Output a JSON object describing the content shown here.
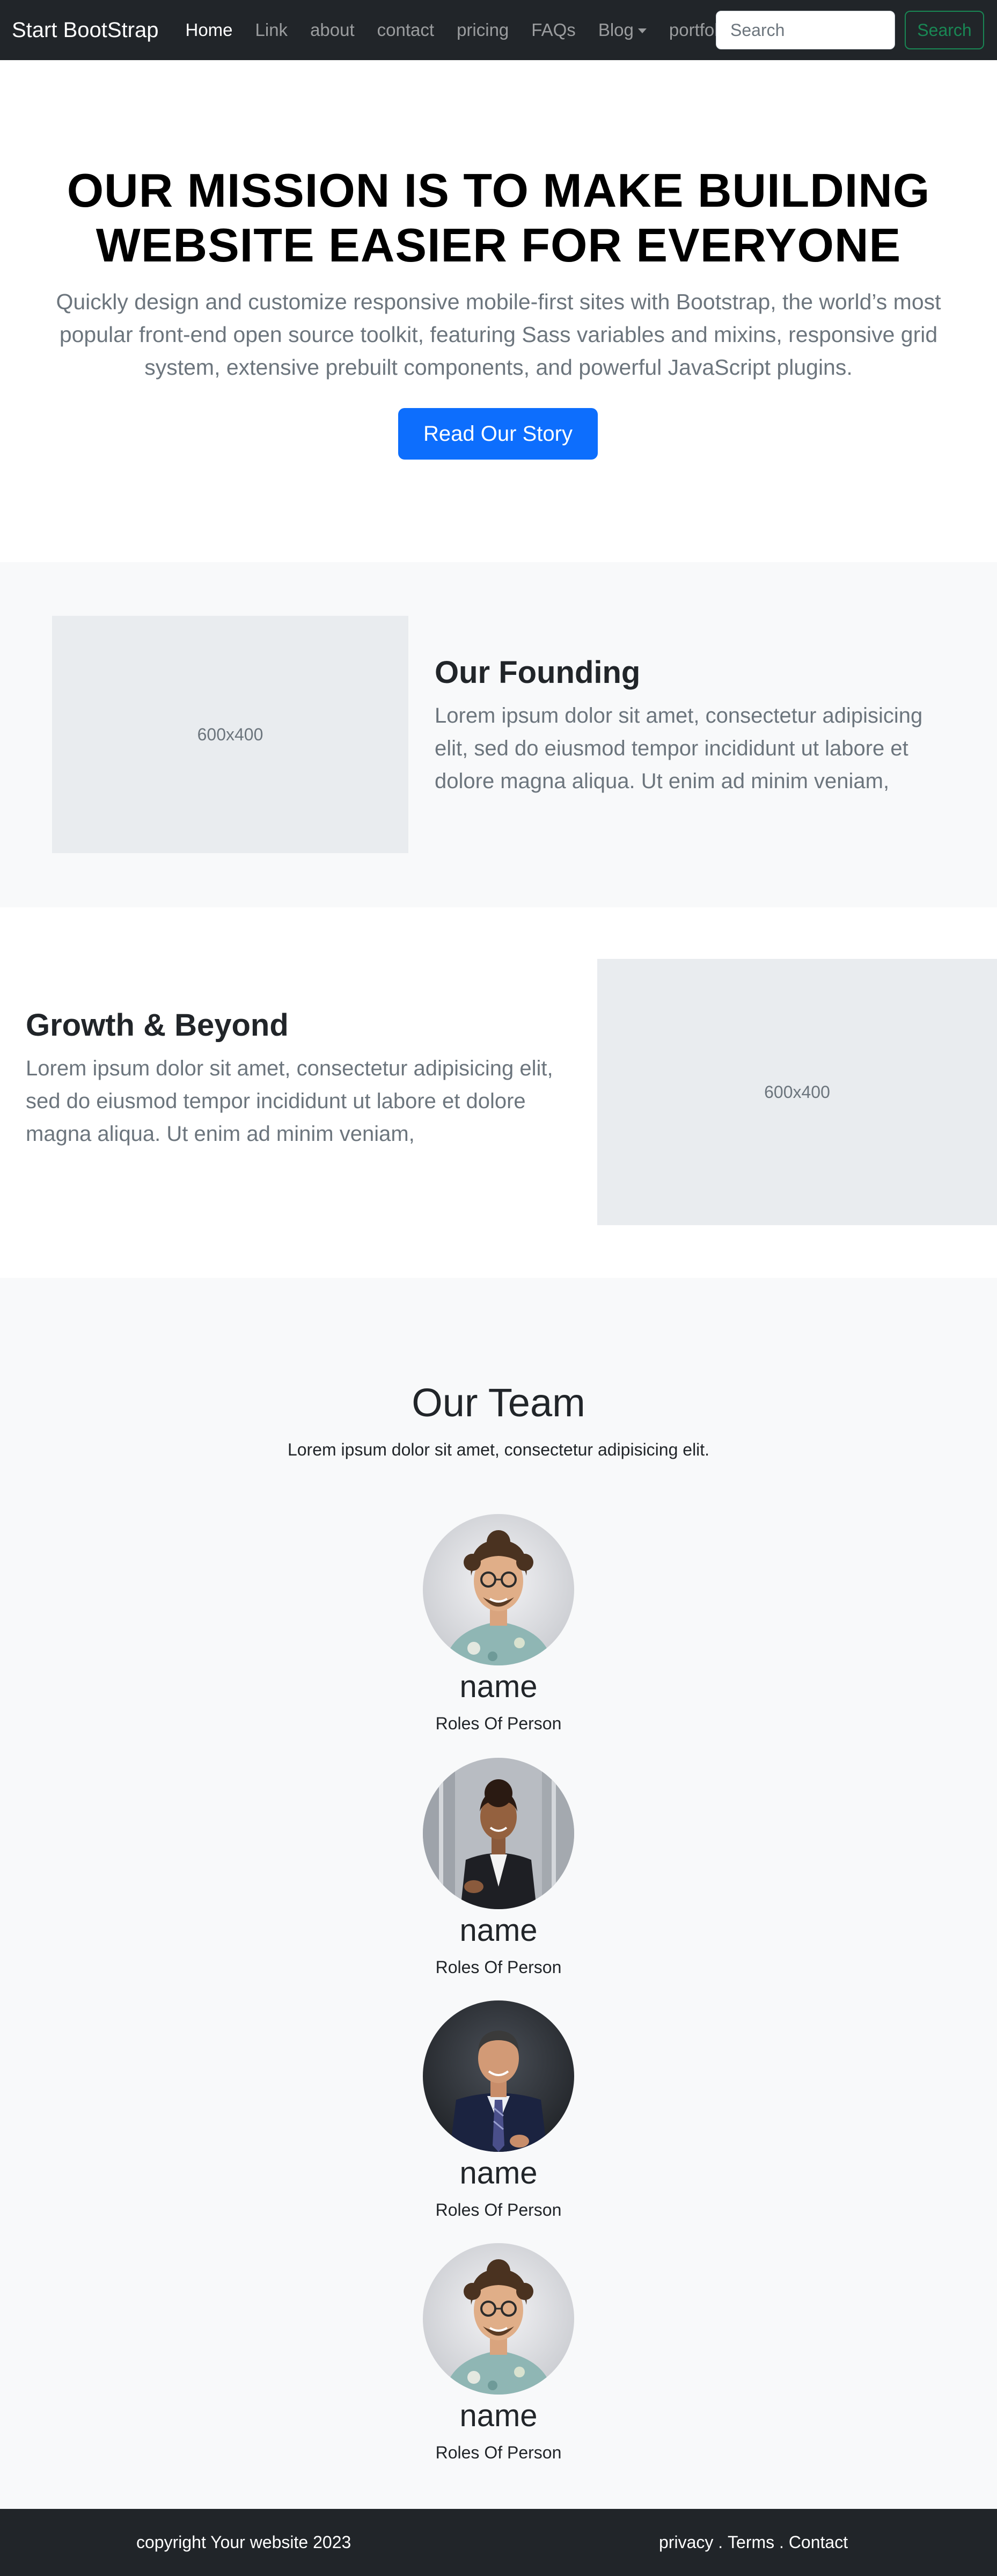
{
  "navbar": {
    "brand": "Start BootStrap",
    "links": [
      {
        "label": "Home"
      },
      {
        "label": "Link"
      },
      {
        "label": "about"
      },
      {
        "label": "contact"
      },
      {
        "label": "pricing"
      },
      {
        "label": "FAQs"
      },
      {
        "label": "Blog"
      },
      {
        "label": "portfolio"
      }
    ],
    "search_placeholder": "Search",
    "search_button": "Search"
  },
  "hero": {
    "title": "OUR MISSION IS TO MAKE BUILDING WEBSITE EASIER FOR EVERYONE",
    "text": "Quickly design and customize responsive mobile-first sites with Bootstrap, the world’s most popular front-end open source toolkit, featuring Sass variables and mixins, responsive grid system, extensive prebuilt components, and powerful JavaScript plugins.",
    "button": "Read Our Story"
  },
  "founding": {
    "image_label": "600x400",
    "title": "Our Founding",
    "text": "Lorem ipsum dolor sit amet, consectetur adipisicing elit, sed do eiusmod tempor incididunt ut labore et dolore magna aliqua. Ut enim ad minim veniam,"
  },
  "growth": {
    "title": "Growth & Beyond",
    "text": "Lorem ipsum dolor sit amet, consectetur adipisicing elit, sed do eiusmod tempor incididunt ut labore et dolore magna aliqua. Ut enim ad minim veniam,",
    "image_label": "600x400"
  },
  "team": {
    "title": "Our Team",
    "subtitle": "Lorem ipsum dolor sit amet, consectetur adipisicing elit.",
    "members": [
      {
        "name": "name",
        "role": "Roles Of Person"
      },
      {
        "name": "name",
        "role": "Roles Of Person"
      },
      {
        "name": "name",
        "role": "Roles Of Person"
      },
      {
        "name": "name",
        "role": "Roles Of Person"
      }
    ]
  },
  "footer": {
    "copyright": "copyright Your website 2023",
    "privacy": "privacy",
    "sep1": " . ",
    "terms": "Terms",
    "sep2": " . ",
    "contact": "Contact"
  },
  "colors": {
    "navbar_bg": "#212529",
    "primary": "#0d6efd",
    "success": "#198754",
    "light_bg": "#f8f9fa",
    "placeholder_bg": "#e9ecef"
  }
}
